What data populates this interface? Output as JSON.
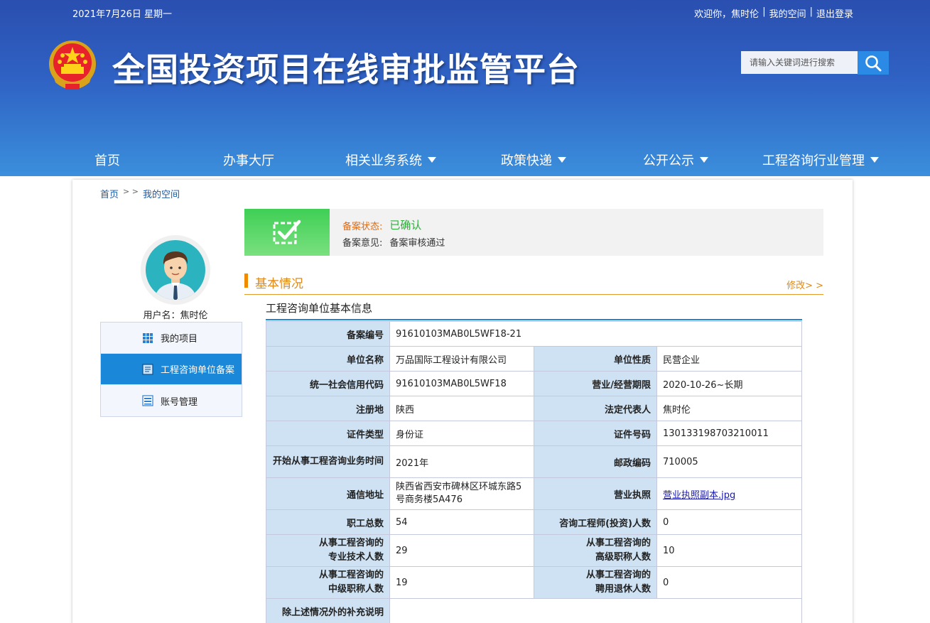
{
  "header": {
    "date": "2021年7月26日 星期一",
    "welcome": "欢迎你，焦时伦",
    "my_space": "我的空间",
    "logout": "退出登录",
    "site_title": "全国投资项目在线审批监管平台",
    "search_placeholder": "请输入关键词进行搜索"
  },
  "nav": [
    {
      "label": "首页",
      "dropdown": false
    },
    {
      "label": "办事大厅",
      "dropdown": false
    },
    {
      "label": "相关业务系统",
      "dropdown": true
    },
    {
      "label": "政策快递",
      "dropdown": true
    },
    {
      "label": "公开公示",
      "dropdown": true
    },
    {
      "label": "工程咨询行业管理",
      "dropdown": true
    }
  ],
  "breadcrumb": {
    "home": "首页",
    "arrow": "> >",
    "current": "我的空间"
  },
  "user": {
    "label": "用户名：焦时伦"
  },
  "side_menu": [
    {
      "label": "我的项目",
      "icon": "grid-icon",
      "active": false
    },
    {
      "label": "工程咨询单位备案",
      "icon": "document-icon",
      "active": true
    },
    {
      "label": "账号管理",
      "icon": "list-icon",
      "active": false
    }
  ],
  "status": {
    "label": "备案状态:",
    "value": "已确认",
    "opinion_label": "备案意见:",
    "opinion_value": "备案审核通过"
  },
  "section": {
    "title": "基本情况",
    "edit": "修改> >",
    "subtitle": "工程咨询单位基本信息"
  },
  "table": {
    "record_no_label": "备案编号",
    "record_no": "91610103MAB0L5WF18-21",
    "unit_name_label": "单位名称",
    "unit_name": "万品国际工程设计有限公司",
    "unit_type_label": "单位性质",
    "unit_type": "民营企业",
    "credit_code_label": "统一社会信用代码",
    "credit_code": "91610103MAB0L5WF18",
    "term_label": "营业/经营期限",
    "term": "2020-10-26~长期",
    "reg_place_label": "注册地",
    "reg_place": "陕西",
    "legal_rep_label": "法定代表人",
    "legal_rep": "焦时伦",
    "id_type_label": "证件类型",
    "id_type": "身份证",
    "id_no_label": "证件号码",
    "id_no": "130133198703210011",
    "start_time_label": "开始从事工程咨询业务时间",
    "start_time": "2021年",
    "postcode_label": "邮政编码",
    "postcode": "710005",
    "address_label": "通信地址",
    "address": "陕西省西安市碑林区环城东路5号商务楼5A476",
    "license_label": "营业执照",
    "license": "营业执照副本.jpg",
    "staff_label": "职工总数",
    "staff": "54",
    "engineers_label": "咨询工程师(投资)人数",
    "engineers": "0",
    "pro_staff_label_1": "从事工程咨询的",
    "pro_staff_label_2": "专业技术人数",
    "pro_staff": "29",
    "senior_label_1": "从事工程咨询的",
    "senior_label_2": "高级职称人数",
    "senior": "10",
    "mid_label_1": "从事工程咨询的",
    "mid_label_2": "中级职称人数",
    "mid": "19",
    "retired_label_1": "从事工程咨询的",
    "retired_label_2": "聘用退休人数",
    "retired": "0",
    "extra_label": "除上述情况外的补充说明",
    "extra": ""
  }
}
